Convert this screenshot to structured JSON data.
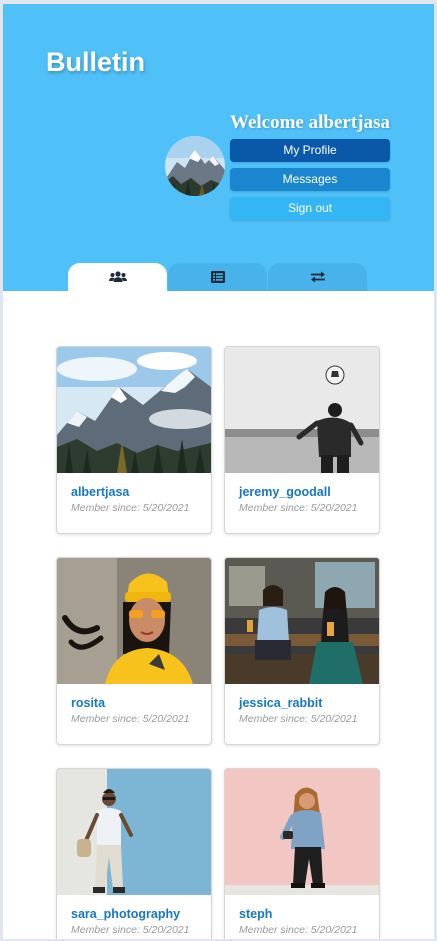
{
  "app": {
    "brand": "Bulletin"
  },
  "header": {
    "welcome": "Welcome albertjasa",
    "buttons": {
      "profile": "My Profile",
      "messages": "Messages",
      "signout": "Sign out"
    }
  },
  "tabs": [
    {
      "icon": "users-icon",
      "active": true
    },
    {
      "icon": "list-icon",
      "active": false
    },
    {
      "icon": "exchange-icon",
      "active": false
    }
  ],
  "members": [
    {
      "username": "albertjasa",
      "since": "Member since: 5/20/2021",
      "photo": "mountains"
    },
    {
      "username": "jeremy_goodall",
      "since": "Member since: 5/20/2021",
      "photo": "soccer-beach"
    },
    {
      "username": "rosita",
      "since": "Member since: 5/20/2021",
      "photo": "yellow-beanie"
    },
    {
      "username": "jessica_rabbit",
      "since": "Member since: 5/20/2021",
      "photo": "two-friends-bar"
    },
    {
      "username": "sara_photography",
      "since": "Member since: 5/20/2021",
      "photo": "blue-wall"
    },
    {
      "username": "steph",
      "since": "Member since: 5/20/2021",
      "photo": "pink-wall"
    }
  ],
  "colors": {
    "header": "#4fc0f8",
    "profile_button": "#0a58a8",
    "messages_button": "#1a86d0",
    "signout_button": "#34b6f4",
    "username": "#1677c2"
  }
}
